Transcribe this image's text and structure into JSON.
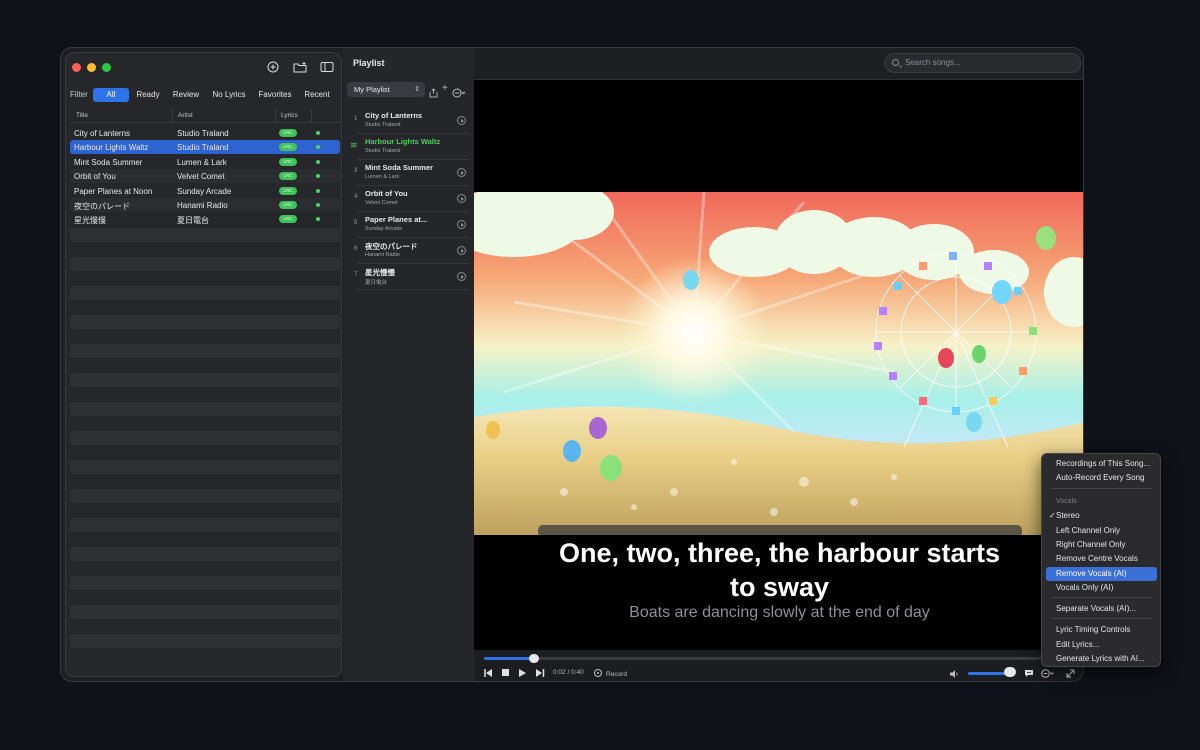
{
  "sidebar": {
    "filter_label": "Filter",
    "filters": [
      "All",
      "Ready",
      "Review",
      "No Lyrics",
      "Favorites",
      "Recent"
    ],
    "columns": {
      "title": "Title",
      "artist": "Artist",
      "lyrics": "Lyrics"
    },
    "lrc_badge": "LRC",
    "rows": [
      {
        "title": "City of Lanterns",
        "artist": "Studio Traland"
      },
      {
        "title": "Harbour Lights Waltz",
        "artist": "Studio Traland"
      },
      {
        "title": "Mint Soda Summer",
        "artist": "Lumen & Lark"
      },
      {
        "title": "Orbit of You",
        "artist": "Velvet Comet"
      },
      {
        "title": "Paper Planes at Noon",
        "artist": "Sunday Arcade"
      },
      {
        "title": "夜空のパレード",
        "artist": "Hanami Radio"
      },
      {
        "title": "星光慢慢",
        "artist": "夏日電台"
      }
    ]
  },
  "playlist": {
    "title": "Playlist",
    "selector": "My Playlist",
    "items": [
      {
        "num": "1",
        "title": "City of Lanterns",
        "artist": "Studio Traland"
      },
      {
        "num": "",
        "title": "Harbour Lights Waltz",
        "artist": "Studio Traland"
      },
      {
        "num": "3",
        "title": "Mint Soda Summer",
        "artist": "Lumen & Lark"
      },
      {
        "num": "4",
        "title": "Orbit of You",
        "artist": "Velvet Comet"
      },
      {
        "num": "5",
        "title": "Paper Planes at...",
        "artist": "Sunday Arcade"
      },
      {
        "num": "6",
        "title": "夜空のパレード",
        "artist": "Hanami Radio"
      },
      {
        "num": "7",
        "title": "星光慢慢",
        "artist": "夏日電台"
      }
    ]
  },
  "search": {
    "placeholder": "Search songs..."
  },
  "lyrics": {
    "line1": "One, two, three, the harbour starts",
    "line1b": "to sway",
    "line2": "Boats are dancing slowly at the end of day"
  },
  "player": {
    "time": "0:02 / 0:40",
    "record_label": "Record",
    "progress": 0.08,
    "volume": 0.85
  },
  "menu": {
    "items": [
      "Recordings of This Song...",
      "Auto-Record Every Song",
      "Vocals",
      "Stereo",
      "Left Channel Only",
      "Right Channel Only",
      "Remove Centre Vocals",
      "Remove Vocals (AI)",
      "Vocals Only (AI)",
      "Separate Vocals (AI)...",
      "Lyric Timing Controls",
      "Edit Lyrics...",
      "Generate Lyrics with AI..."
    ]
  },
  "colors": {
    "accent": "#2f73e8",
    "ready_green": "#3ec35a",
    "playing_green": "#4ecb5e"
  }
}
